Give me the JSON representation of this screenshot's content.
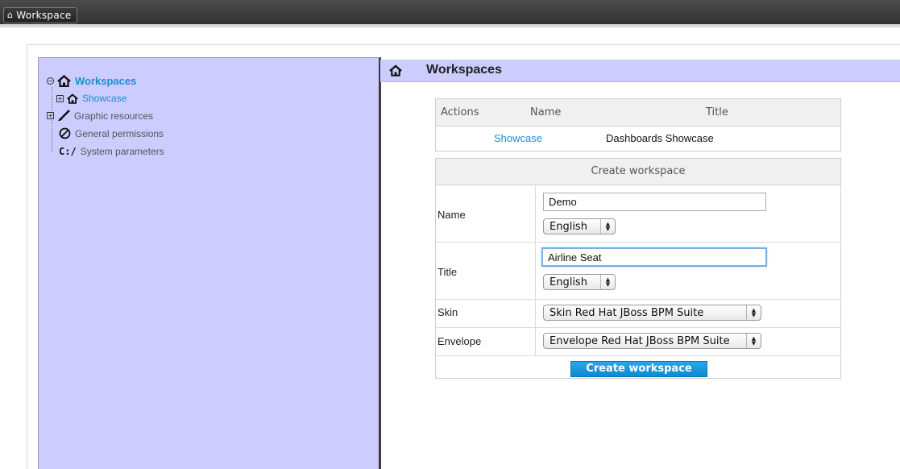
{
  "topbar": {
    "button_label": "Workspace"
  },
  "tree": {
    "root": {
      "label": "Workspaces",
      "toggle": "−"
    },
    "child": {
      "label": "Showcase",
      "toggle": "+"
    },
    "items": [
      {
        "label": "Graphic resources",
        "toggle": "+"
      },
      {
        "label": "General permissions"
      },
      {
        "label": "System parameters",
        "icon_text": "C:/"
      }
    ]
  },
  "main": {
    "title": "Workspaces"
  },
  "workspaces_table": {
    "columns": [
      "Actions",
      "Name",
      "Title"
    ],
    "rows": [
      {
        "name": "Showcase",
        "title": "Dashboards Showcase"
      }
    ]
  },
  "create_form": {
    "header": "Create workspace",
    "name": {
      "label": "Name",
      "value": "Demo",
      "language": "English"
    },
    "title": {
      "label": "Title",
      "value": "Airline Seat",
      "language": "English"
    },
    "skin": {
      "label": "Skin",
      "value": "Skin Red Hat JBoss BPM Suite"
    },
    "envelope": {
      "label": "Envelope",
      "value": "Envelope Red Hat JBoss BPM Suite"
    },
    "submit_label": "Create workspace"
  },
  "colors": {
    "panel": "#ccccff",
    "link": "#1a8fd1",
    "button": "#1196d9",
    "topbar": "#3a3a3a"
  }
}
